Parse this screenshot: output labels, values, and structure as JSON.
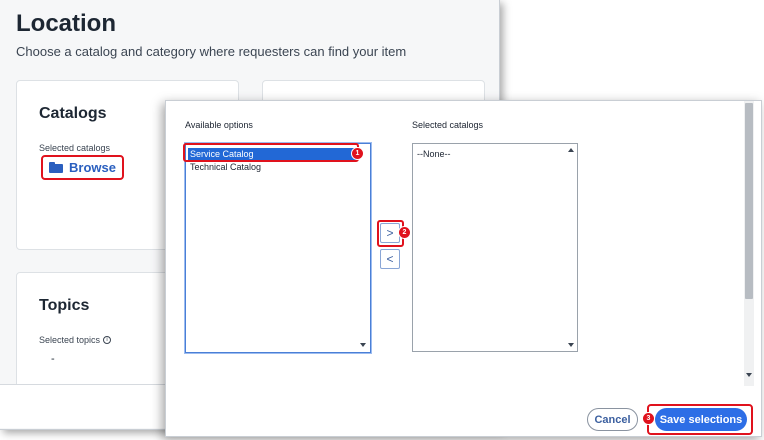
{
  "page": {
    "title": "Location",
    "subtitle": "Choose a catalog and category where requesters can find your item"
  },
  "catalogs_card": {
    "heading": "Catalogs",
    "selected_label": "Selected catalogs",
    "browse_label": "Browse"
  },
  "topics_card": {
    "heading": "Topics",
    "selected_label": "Selected topics",
    "value": "-"
  },
  "modal": {
    "available_label": "Available options",
    "selected_label": "Selected catalogs",
    "available_options": [
      "Service Catalog",
      "Technical Catalog"
    ],
    "selected_options": [
      "--None--"
    ],
    "move_right_symbol": ">",
    "move_left_symbol": "<",
    "cancel_label": "Cancel",
    "save_label": "Save selections"
  },
  "annotations": {
    "step_1": "1",
    "step_2": "2",
    "step_3": "3"
  },
  "colors": {
    "highlight": "#e0121d",
    "primary": "#2d6ee6",
    "selected_option": "#2268d6"
  }
}
